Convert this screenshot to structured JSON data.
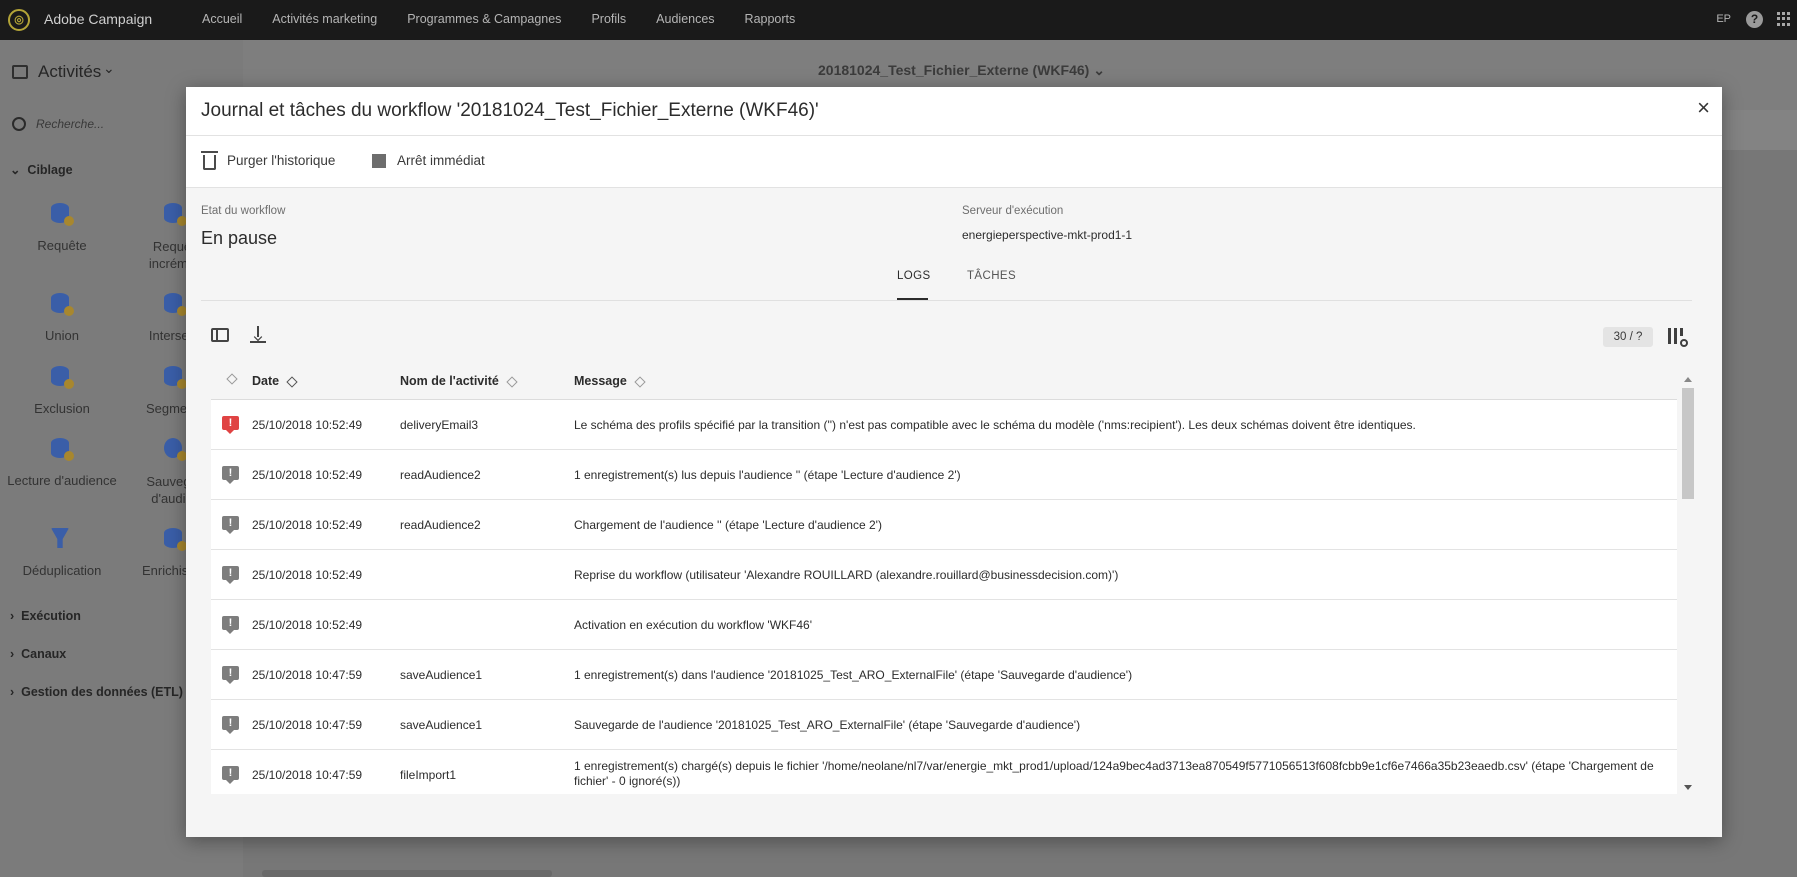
{
  "app": {
    "brand": "Adobe Campaign",
    "nav": [
      "Accueil",
      "Activités marketing",
      "Programmes & Campagnes",
      "Profils",
      "Audiences",
      "Rapports"
    ],
    "user_initials": "EP",
    "help_label": "?"
  },
  "background": {
    "panel_title": "Activités",
    "search_placeholder": "Recherche...",
    "sections": {
      "ciblage": "Ciblage",
      "execution": "Exécution",
      "canaux": "Canaux",
      "etl": "Gestion des données (ETL)"
    },
    "activities": [
      {
        "label": "Requête",
        "icon": "database-icon"
      },
      {
        "label": "Requê incréme",
        "icon": "database-icon"
      },
      {
        "label": "Union",
        "icon": "database-icon"
      },
      {
        "label": "Intersec",
        "icon": "database-icon"
      },
      {
        "label": "Exclusion",
        "icon": "database-icon"
      },
      {
        "label": "Segment",
        "icon": "database-icon"
      },
      {
        "label": "Lecture d'audience",
        "icon": "database-icon"
      },
      {
        "label": "Sauvega d'audie",
        "icon": "user-icon"
      },
      {
        "label": "Déduplication",
        "icon": "funnel-icon"
      },
      {
        "label": "Enrichisse",
        "icon": "database-icon"
      }
    ],
    "page_title": "20181024_Test_Fichier_Externe (WKF46)"
  },
  "modal": {
    "title": "Journal et tâches du workflow '20181024_Test_Fichier_Externe (WKF46)'",
    "close_label": "×",
    "purge_label": "Purger l'historique",
    "stop_label": "Arrêt immédiat",
    "state_label": "Etat du workflow",
    "state_value": "En pause",
    "server_label": "Serveur d'exécution",
    "server_value": "energieperspective-mkt-prod1-1",
    "tabs": {
      "logs": "LOGS",
      "tasks": "TÂCHES"
    },
    "count": "30 / ?",
    "columns": {
      "date": "Date",
      "activity": "Nom de l'activité",
      "message": "Message"
    },
    "rows": [
      {
        "type": "error",
        "date": "25/10/2018 10:52:49",
        "activity": "deliveryEmail3",
        "message": "Le schéma des profils spécifié par la transition ('') n'est pas compatible avec le schéma du modèle ('nms:recipient'). Les deux schémas doivent être identiques."
      },
      {
        "type": "info",
        "date": "25/10/2018 10:52:49",
        "activity": "readAudience2",
        "message": "1 enregistrement(s) lus depuis l'audience '' (étape 'Lecture d'audience 2')"
      },
      {
        "type": "info",
        "date": "25/10/2018 10:52:49",
        "activity": "readAudience2",
        "message": "Chargement de l'audience '' (étape 'Lecture d'audience 2')"
      },
      {
        "type": "info",
        "date": "25/10/2018 10:52:49",
        "activity": "",
        "message": "Reprise du workflow (utilisateur 'Alexandre ROUILLARD (alexandre.rouillard@businessdecision.com)')"
      },
      {
        "type": "info",
        "date": "25/10/2018 10:52:49",
        "activity": "",
        "message": "Activation en exécution du workflow 'WKF46'"
      },
      {
        "type": "info",
        "date": "25/10/2018 10:47:59",
        "activity": "saveAudience1",
        "message": "1 enregistrement(s) dans l'audience '20181025_Test_ARO_ExternalFile' (étape 'Sauvegarde d'audience')"
      },
      {
        "type": "info",
        "date": "25/10/2018 10:47:59",
        "activity": "saveAudience1",
        "message": "Sauvegarde de l'audience '20181025_Test_ARO_ExternalFile' (étape 'Sauvegarde d'audience')"
      },
      {
        "type": "info",
        "date": "25/10/2018 10:47:59",
        "activity": "fileImport1",
        "message": "1 enregistrement(s) chargé(s) depuis le fichier '/home/neolane/nl7/var/energie_mkt_prod1/upload/124a9bec4ad3713ea870549f5771056513f608fcbb9e1cf6e7466a35b23eaedb.csv' (étape 'Chargement de fichier' - 0 ignoré(s))"
      }
    ]
  }
}
